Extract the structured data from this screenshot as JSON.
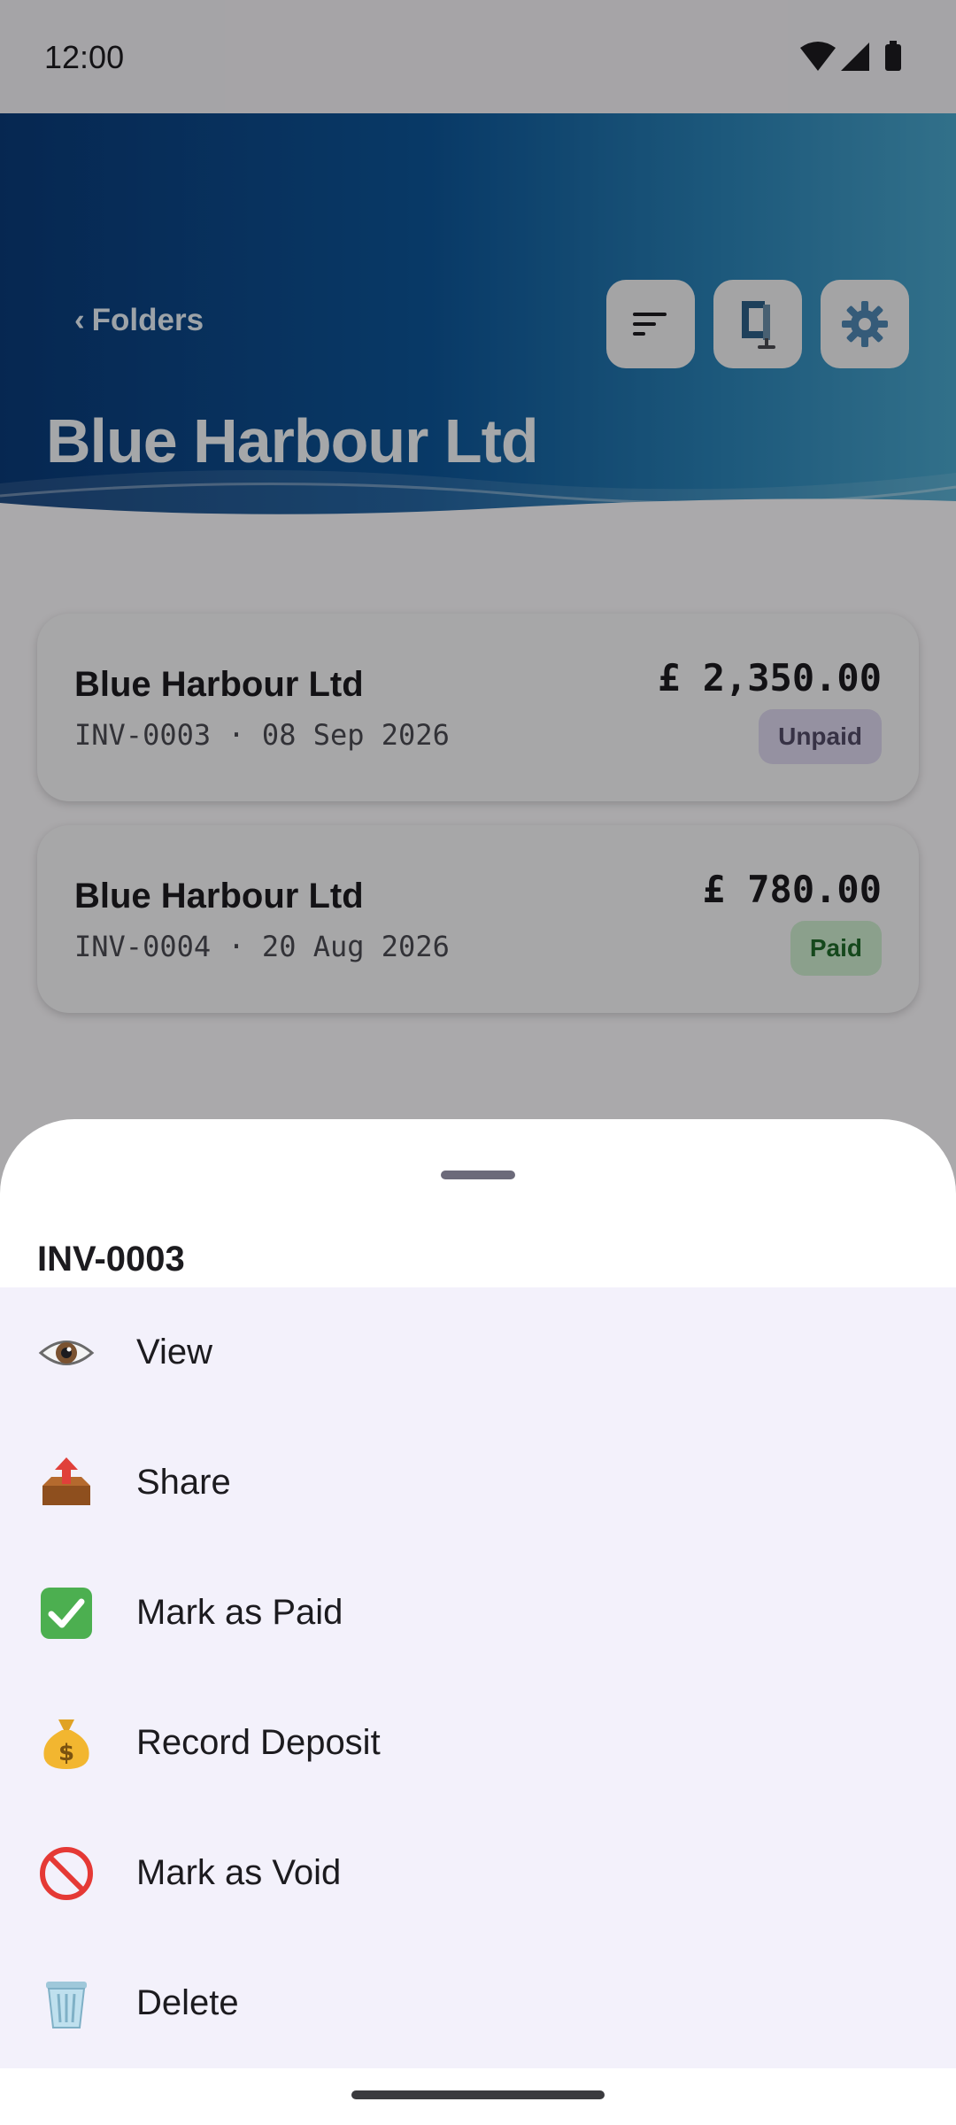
{
  "status_bar": {
    "time": "12:00"
  },
  "header": {
    "back_label": "Folders",
    "title": "Blue Harbour Ltd",
    "buttons": [
      "sort-icon",
      "clamp-icon",
      "gear-icon"
    ]
  },
  "invoices": [
    {
      "client": "Blue Harbour Ltd",
      "meta": "INV-0003 · 08 Sep 2026",
      "amount": "£ 2,350.00",
      "status": "Unpaid"
    },
    {
      "client": "Blue Harbour Ltd",
      "meta": "INV-0004 · 20 Aug 2026",
      "amount": "£ 780.00",
      "status": "Paid"
    }
  ],
  "sheet": {
    "title": "INV-0003",
    "items": [
      {
        "label": "View",
        "icon": "eye-icon"
      },
      {
        "label": "Share",
        "icon": "outbox-tray-icon"
      },
      {
        "label": "Mark as Paid",
        "icon": "check-mark-icon"
      },
      {
        "label": "Record Deposit",
        "icon": "money-bag-icon"
      },
      {
        "label": "Mark as Void",
        "icon": "prohibited-icon"
      },
      {
        "label": "Delete",
        "icon": "wastebasket-icon"
      }
    ]
  },
  "colors": {
    "header_start": "#0a3a78",
    "header_end": "#4aa6cc",
    "unpaid_badge": "#dcd6ee",
    "paid_badge": "#cdeccf",
    "sheet_menu_bg": "#f3f1fb"
  }
}
